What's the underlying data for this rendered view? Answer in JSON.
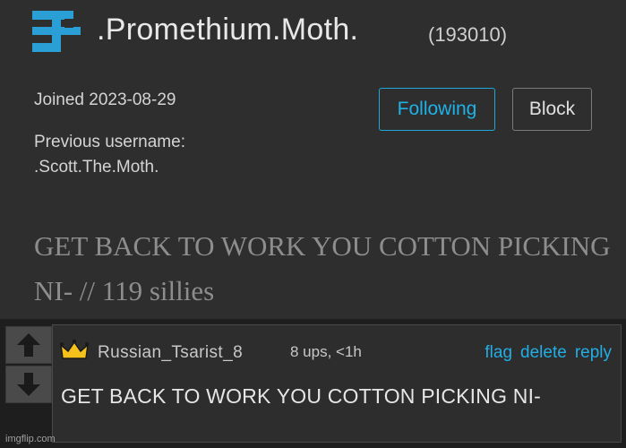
{
  "profile": {
    "username": ".Promethium.Moth.",
    "user_id": "(193010)",
    "joined": "Joined 2023-08-29",
    "previous_username_label": "Previous username:",
    "previous_username": ".Scott.The.Moth.",
    "follow_button": "Following",
    "block_button": "Block",
    "bio": "GET BACK TO WORK YOU COTTON PICKING NI- // 119 sillies",
    "avatar_icon": "pixel-avatar-icon",
    "accent_color": "#1fb2e6"
  },
  "comment": {
    "username": "Russian_Tsarist_8",
    "meta": "8 ups, <1h",
    "actions": {
      "flag": "flag",
      "delete": "delete",
      "reply": "reply"
    },
    "text": "GET BACK TO WORK YOU COTTON PICKING NI-",
    "badge_icon": "crown-icon",
    "upvote_icon": "arrow-up-icon",
    "downvote_icon": "arrow-down-icon"
  },
  "watermark": "imgflip.com"
}
